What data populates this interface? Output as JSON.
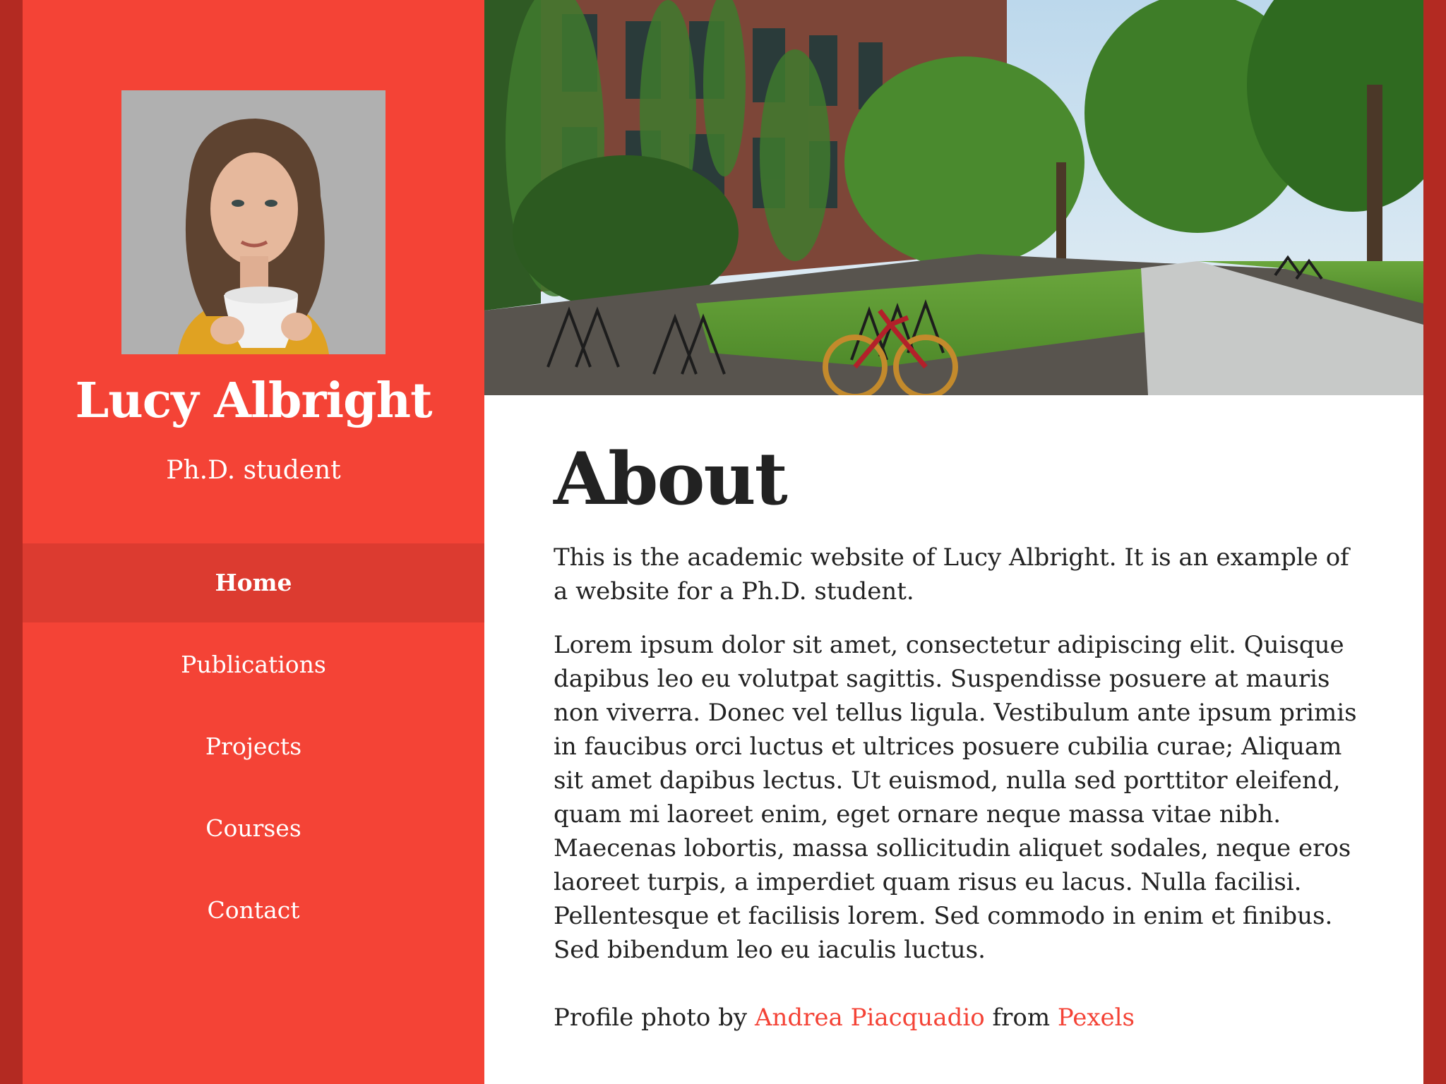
{
  "sidebar": {
    "name": "Lucy Albright",
    "role": "Ph.D. student",
    "nav": [
      {
        "label": "Home",
        "active": true
      },
      {
        "label": "Publications",
        "active": false
      },
      {
        "label": "Projects",
        "active": false
      },
      {
        "label": "Courses",
        "active": false
      },
      {
        "label": "Contact",
        "active": false
      }
    ]
  },
  "main": {
    "heading": "About",
    "intro": "This is the academic website of Lucy Albright. It is an example of a website for a Ph.D. student.",
    "body": "Lorem ipsum dolor sit amet, consectetur adipiscing elit. Quisque dapibus leo eu volutpat sagittis. Suspendisse posuere at mauris non viverra. Donec vel tellus ligula. Vestibulum ante ipsum primis in faucibus orci luctus et ultrices posuere cubilia curae; Aliquam sit amet dapibus lectus. Ut euismod, nulla sed porttitor eleifend, quam mi laoreet enim, eget ornare neque massa vitae nibh. Maecenas lobortis, massa sollicitudin aliquet sodales, neque eros laoreet turpis, a imperdiet quam risus eu lacus. Nulla facilisi. Pellentesque et facilisis lorem. Sed commodo in enim et finibus. Sed bibendum leo eu iaculis luctus.",
    "credit": {
      "prefix": "Profile photo by ",
      "author": "Andrea Piacquadio",
      "middle": " from ",
      "source": "Pexels"
    }
  },
  "colors": {
    "accent": "#f44336",
    "accent_dark": "#dc3b30",
    "frame": "#b32a22"
  }
}
